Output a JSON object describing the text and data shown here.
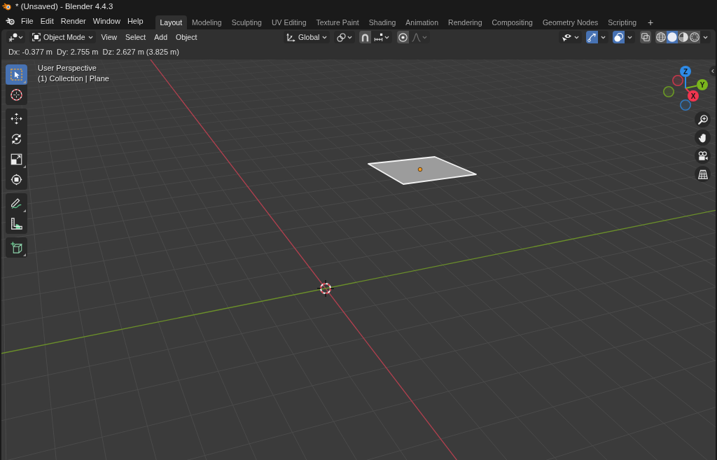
{
  "title_bar": {
    "title": "* (Unsaved) - Blender 4.4.3"
  },
  "top_bar": {
    "menus": [
      "File",
      "Edit",
      "Render",
      "Window",
      "Help"
    ],
    "workspaces": [
      {
        "label": "Layout",
        "selected": true
      },
      {
        "label": "Modeling",
        "selected": false
      },
      {
        "label": "Sculpting",
        "selected": false
      },
      {
        "label": "UV Editing",
        "selected": false
      },
      {
        "label": "Texture Paint",
        "selected": false
      },
      {
        "label": "Shading",
        "selected": false
      },
      {
        "label": "Animation",
        "selected": false
      },
      {
        "label": "Rendering",
        "selected": false
      },
      {
        "label": "Compositing",
        "selected": false
      },
      {
        "label": "Geometry Nodes",
        "selected": false
      },
      {
        "label": "Scripting",
        "selected": false
      }
    ],
    "add_workspace": "+"
  },
  "viewport_header": {
    "mode": "Object Mode",
    "menus": [
      "View",
      "Select",
      "Add",
      "Object"
    ],
    "orientation": "Global",
    "snap": {
      "on": false
    },
    "proportional_editing": {
      "on": false
    },
    "falloff": {
      "disabled": true
    },
    "gizmos": {
      "on": true
    },
    "overlays": {
      "on": true
    },
    "xray": {
      "on": false
    },
    "shading": [
      {
        "kind": "wireframe",
        "selected": false
      },
      {
        "kind": "solid",
        "selected": true
      },
      {
        "kind": "material",
        "selected": false
      },
      {
        "kind": "rendered",
        "selected": false
      }
    ]
  },
  "tool_header": {
    "text": "Dx: -0.377 m  Dy: 2.755 m  Dz: 2.627 m (3.825 m)"
  },
  "toolbar": {
    "groups": [
      {
        "tools": [
          {
            "kind": "select_box",
            "selected": true,
            "variants": true
          },
          {
            "kind": "cursor",
            "selected": false,
            "variants": false
          }
        ]
      },
      {
        "tools": [
          {
            "kind": "move",
            "selected": false,
            "variants": false
          },
          {
            "kind": "rotate",
            "selected": false,
            "variants": false
          },
          {
            "kind": "scale",
            "selected": false,
            "variants": true
          },
          {
            "kind": "transform",
            "selected": false,
            "variants": false
          }
        ]
      },
      {
        "tools": [
          {
            "kind": "annotate",
            "selected": false,
            "variants": true
          },
          {
            "kind": "measure",
            "selected": false,
            "variants": false
          }
        ]
      },
      {
        "tools": [
          {
            "kind": "add_cube",
            "selected": false,
            "variants": true
          }
        ]
      }
    ]
  },
  "viewport": {
    "view_name": "User Perspective",
    "context": "(1) Collection | Plane"
  },
  "navigation_gizmo": {
    "axes": [
      {
        "label": "X",
        "color": "#f0354f"
      },
      {
        "label": "Y",
        "color": "#7ab51d"
      },
      {
        "label": "Z",
        "color": "#2e8ae6"
      }
    ]
  }
}
